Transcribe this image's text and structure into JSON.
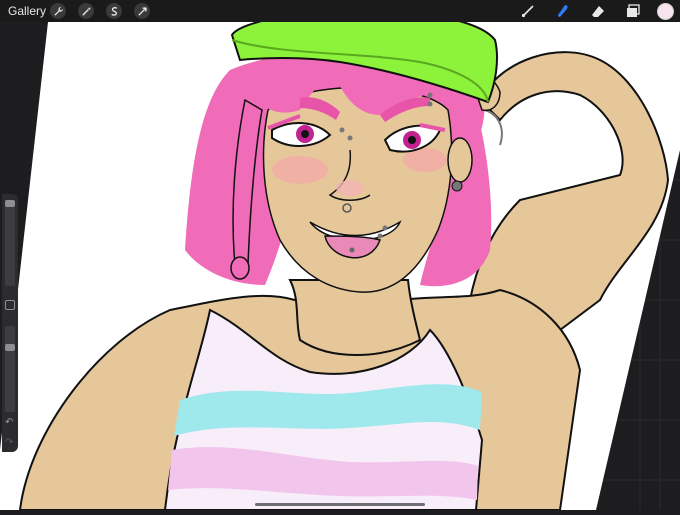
{
  "topbar": {
    "gallery_label": "Gallery",
    "left_tools": [
      "wrench-icon",
      "magic-wand-icon",
      "selection-icon",
      "transform-icon"
    ],
    "right_tools": [
      "brush-icon",
      "smudge-icon",
      "eraser-icon",
      "layers-icon"
    ],
    "active_tool": "smudge-icon",
    "active_color": "#f7e3ec",
    "accent": "#2f7cf6"
  },
  "sidebar": {
    "size_slider_level": 0.04,
    "opacity_slider_level": 0.25,
    "icons": [
      "square-modify-icon",
      "undo-icon",
      "redo-icon"
    ]
  },
  "canvas": {
    "background": "#ffffff",
    "palette": {
      "hat": "#8cf23a",
      "hair": "#f06bb8",
      "skin": "#e6c79a",
      "tongue": "#e889b8",
      "stripe_blue": "#9fe8ec",
      "stripe_pink": "#f2c6ec"
    }
  }
}
